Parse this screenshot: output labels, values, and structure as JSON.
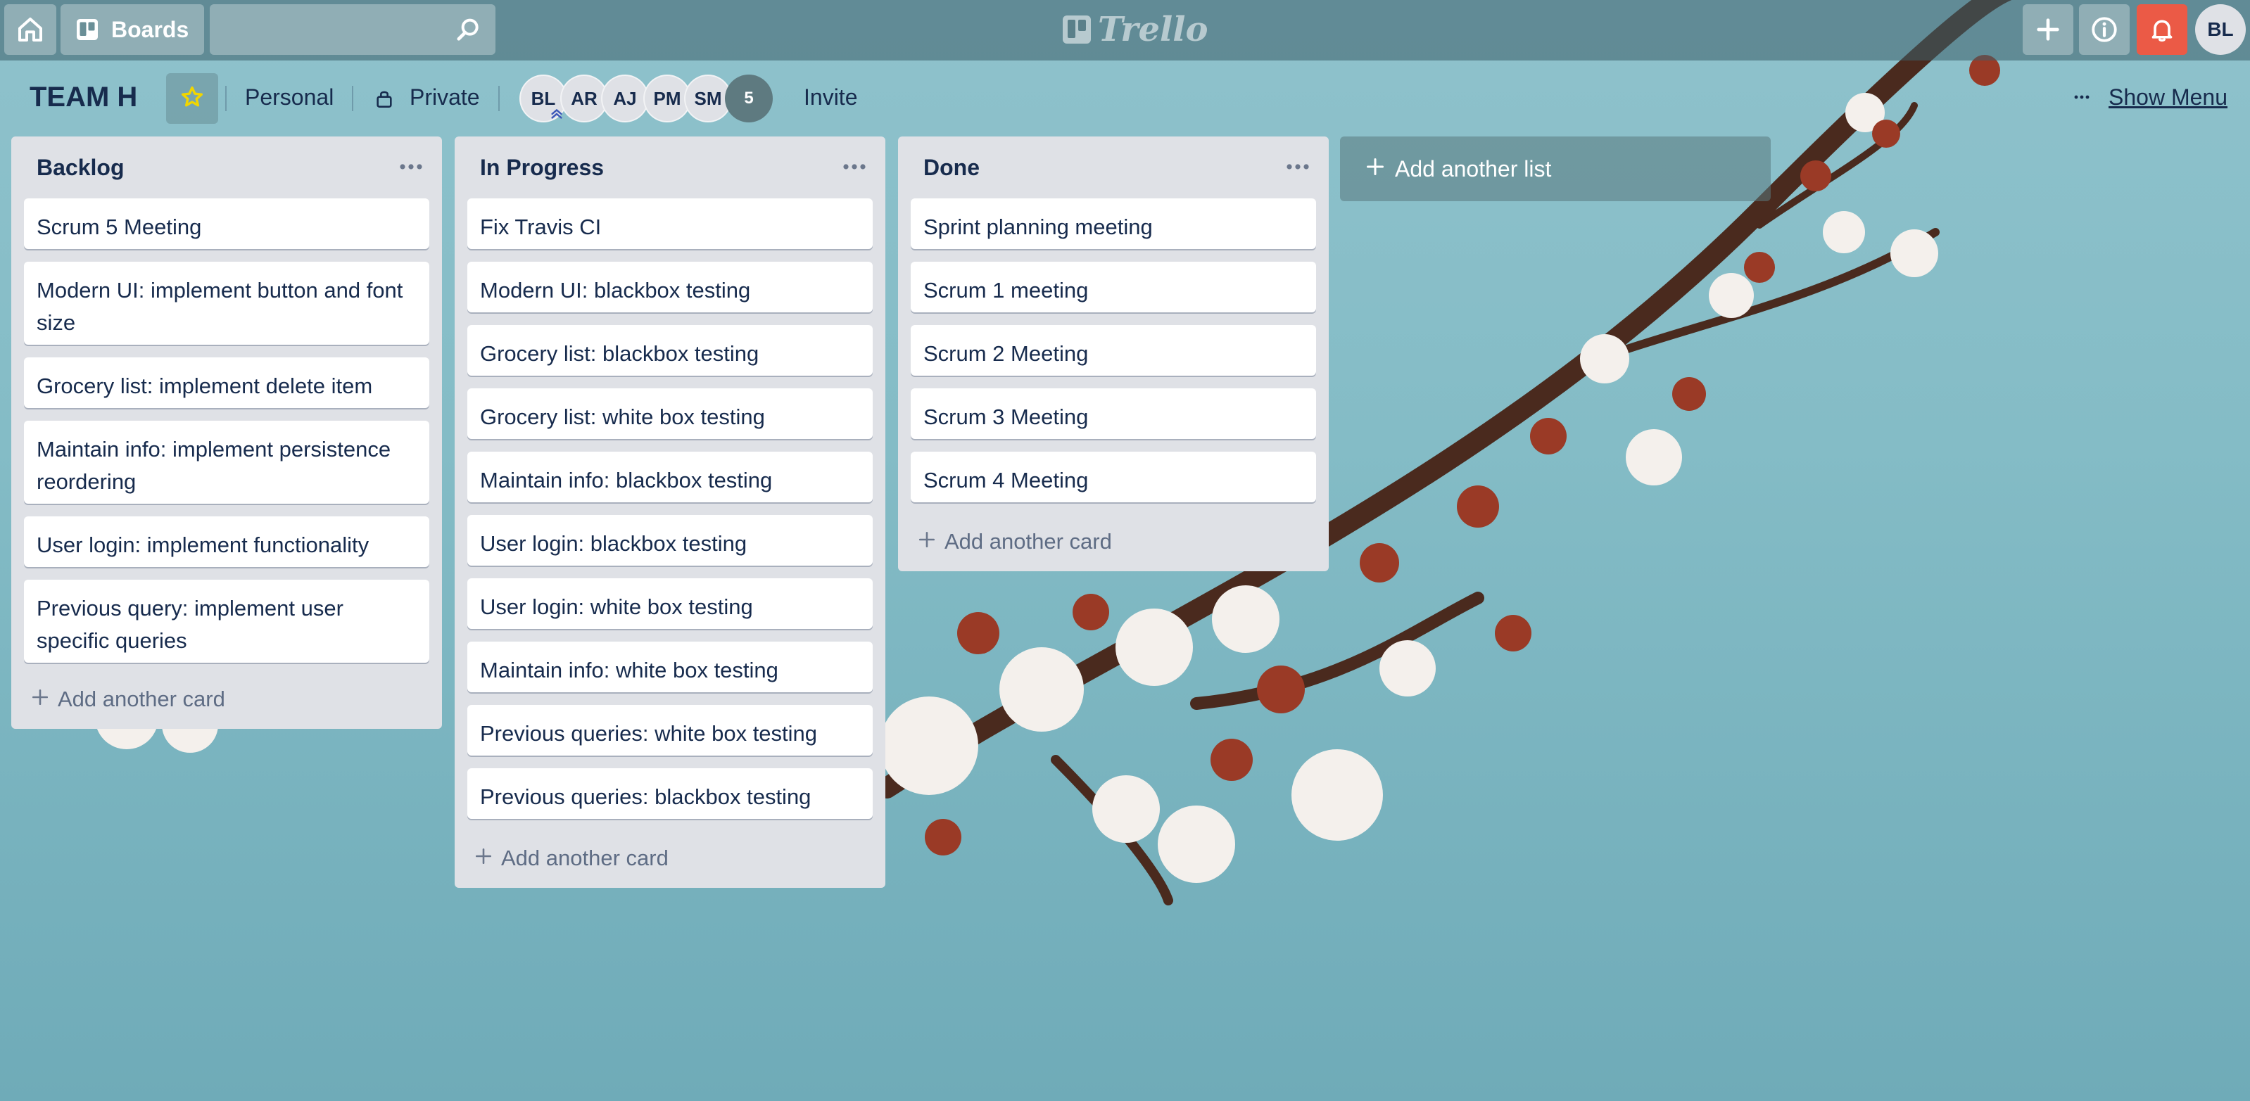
{
  "topbar": {
    "home_icon": "home-icon",
    "boards_label": "Boards",
    "search_value": "",
    "logo_text": "Trello",
    "add_icon": "plus-icon",
    "info_icon": "info-icon",
    "notifications_icon": "bell-icon",
    "user_initials": "BL"
  },
  "board": {
    "title": "TEAM H",
    "starred": true,
    "team_label": "Personal",
    "visibility_label": "Private",
    "members": [
      "BL",
      "AR",
      "AJ",
      "PM",
      "SM"
    ],
    "member_count_badge": "5",
    "invite_label": "Invite",
    "show_menu_label": "Show Menu"
  },
  "lists": [
    {
      "title": "Backlog",
      "cards": [
        "Scrum 5 Meeting",
        "Modern UI: implement button and font size",
        "Grocery list: implement delete item",
        "Maintain info: implement persistence reordering",
        "User login: implement functionality",
        "Previous query: implement user specific queries"
      ],
      "add_card_label": "Add another card"
    },
    {
      "title": "In Progress",
      "cards": [
        "Fix Travis CI",
        "Modern UI: blackbox testing",
        "Grocery list: blackbox testing",
        "Grocery list: white box testing",
        "Maintain info: blackbox testing",
        "User login: blackbox testing",
        "User login: white box testing",
        "Maintain info: white box testing",
        "Previous queries: white box testing",
        "Previous queries: blackbox testing"
      ],
      "add_card_label": "Add another card"
    },
    {
      "title": "Done",
      "cards": [
        "Sprint planning meeting",
        "Scrum 1 meeting",
        "Scrum 2 Meeting",
        "Scrum 3 Meeting",
        "Scrum 4 Meeting"
      ],
      "add_card_label": "Add another card"
    }
  ],
  "add_list_label": "Add another list",
  "colors": {
    "notification_accent": "#eb5a46",
    "star": "#f2d600",
    "list_background": "#dfe1e6",
    "text_primary": "#172b4d"
  }
}
